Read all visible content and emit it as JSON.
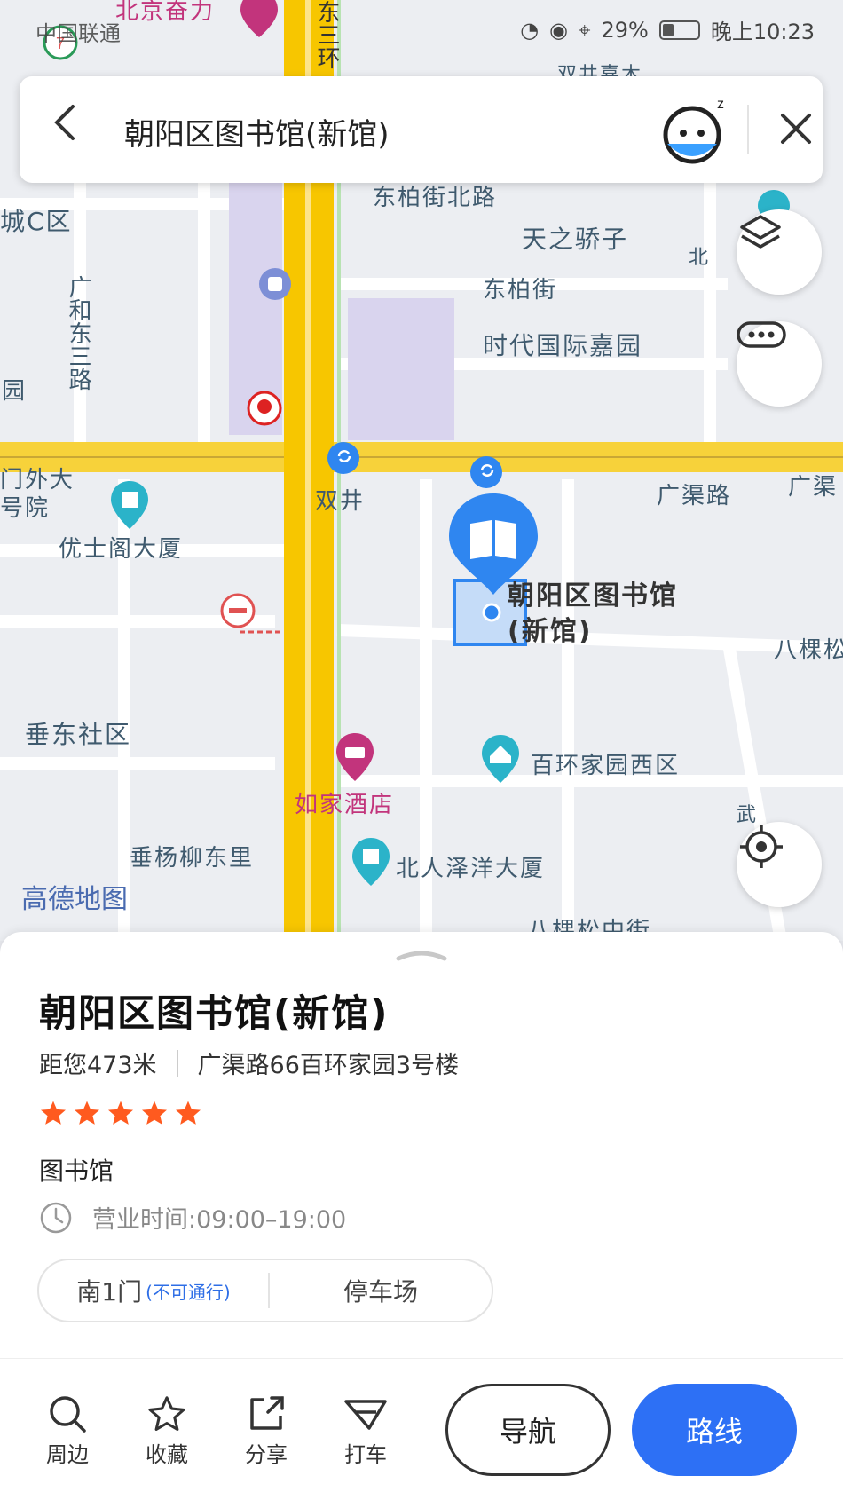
{
  "status_bar": {
    "carrier": "中国联通",
    "battery": "29%",
    "time": "晚上10:23"
  },
  "search": {
    "query": "朝阳区图书馆(新馆)"
  },
  "map": {
    "labels": {
      "dongbai_north": "东柏街北路",
      "tianzhi": "天之骄子",
      "dongbai": "东柏街",
      "shidai": "时代国际嘉园",
      "guanghe": "广和东三路",
      "shuangjing": "双井",
      "guangqu": "广渠路",
      "guangqu2": "广渠",
      "youshige": "优士阁大厦",
      "chuidong": "垂东社区",
      "rujia": "如家酒店",
      "baihuan": "百环家园西区",
      "chuiyang": "垂杨柳东里",
      "beiren": "北人泽洋大厦",
      "bakesong": "八棵松中街",
      "bake2": "八棵松",
      "zone_c": "城C区",
      "yuan": "园",
      "menwai": "门外大",
      "haoyuan": "号院",
      "bei": "北",
      "dongsan": "东三环",
      "wu": "武",
      "top_partial": "北京奋力",
      "ne_partial": "双井嘉木",
      "selected_poi": "朝阳区图书馆(新馆)",
      "watermark": "高德地图"
    }
  },
  "place": {
    "name": "朝阳区图书馆(新馆)",
    "distance": "距您473米",
    "address": "广渠路66百环家园3号楼",
    "rating": 5,
    "category": "图书馆",
    "hours_label": "营业时间:",
    "hours": "09:00–19:00",
    "entrance": "南1门",
    "entrance_note": "(不可通行)",
    "parking": "停车场"
  },
  "toolbar": {
    "nearby": "周边",
    "favorite": "收藏",
    "share": "分享",
    "taxi": "打车",
    "navigate": "导航",
    "route": "路线"
  },
  "colors": {
    "accent": "#2d70f5",
    "star": "#ff5a1f",
    "highway": "#f7c600",
    "marker": "#2f86f0"
  }
}
